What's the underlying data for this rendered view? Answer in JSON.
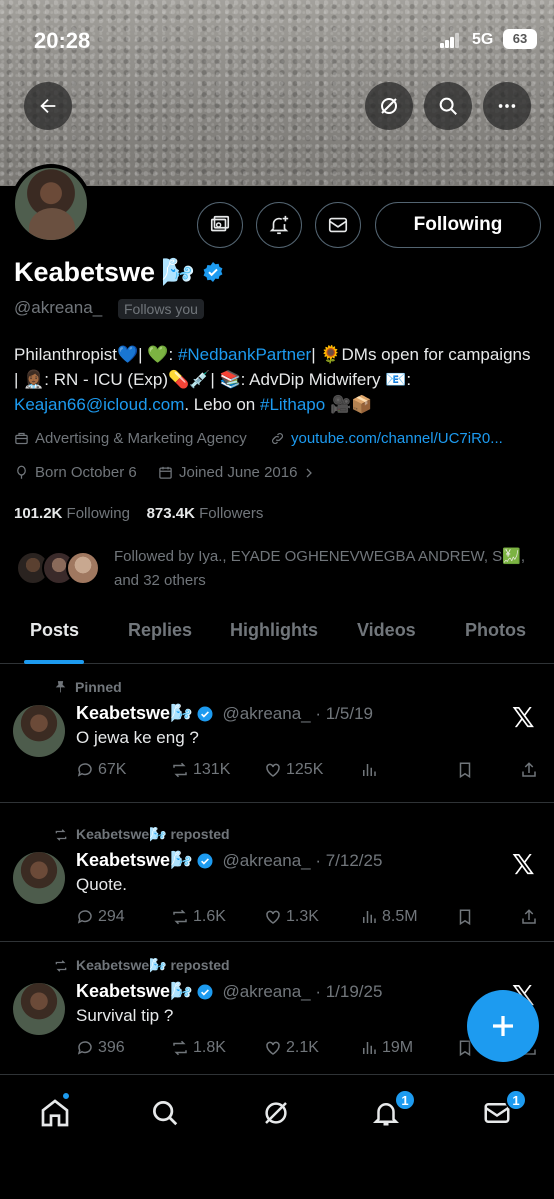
{
  "status": {
    "time": "20:28",
    "network": "5G",
    "battery": "63"
  },
  "profile": {
    "name": "Keabetswe",
    "name_emoji": "🌬️",
    "handle": "@akreana_",
    "follows_you": "Follows you",
    "bio": {
      "p1": "Philanthropist💙| 💚: ",
      "tag1": "#NedbankPartner",
      "p2": "| 🌻DMs open for campaigns | 👩🏾‍⚕️: RN - ICU (Exp)💊💉| 📚: AdvDip Midwifery 📧: ",
      "email": "Keajan66@icloud.com",
      "p3": ". Lebo on ",
      "tag2": "#Lithapo",
      "p4": " 🎥📦"
    },
    "category": "Advertising & Marketing Agency",
    "link": "youtube.com/channel/UC7iR0...",
    "born": "Born October 6",
    "joined": "Joined June 2016",
    "following_count": "101.2K",
    "following_label": "Following",
    "followers_count": "873.4K",
    "followers_label": "Followers",
    "followed_by": "Followed by Iya., EYADE OGHENEVWEGBA ANDREW, S💹, and 32 others"
  },
  "actions": {
    "following_button": "Following"
  },
  "tabs": [
    "Posts",
    "Replies",
    "Highlights",
    "Videos",
    "Photos"
  ],
  "posts": [
    {
      "context": "Pinned",
      "name": "Keabetswe🌬️",
      "handle": "@akreana_ · 1/5/19",
      "text": "O jewa ke eng ?",
      "replies": "67K",
      "reposts": "131K",
      "likes": "125K",
      "views": ""
    },
    {
      "context": "Keabetswe🌬️ reposted",
      "name": "Keabetswe🌬️",
      "handle": "@akreana_ · 7/12/25",
      "text": "Quote.",
      "replies": "294",
      "reposts": "1.6K",
      "likes": "1.3K",
      "views": "8.5M"
    },
    {
      "context": "Keabetswe🌬️ reposted",
      "name": "Keabetswe🌬️",
      "handle": "@akreana_ · 1/19/25",
      "text": "Survival tip ?",
      "replies": "396",
      "reposts": "1.8K",
      "likes": "2.1K",
      "views": "19M"
    }
  ],
  "nav_badges": {
    "notifications": "1",
    "messages": "1"
  },
  "colors": {
    "accent": "#1d9bf0",
    "background": "#000000",
    "muted": "#71767b"
  }
}
